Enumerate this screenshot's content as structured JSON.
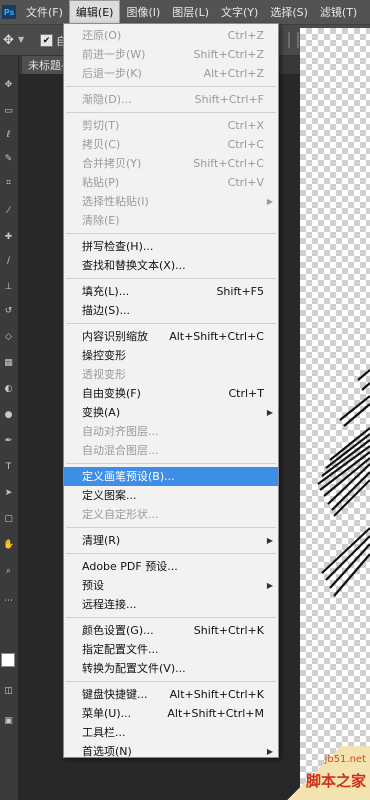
{
  "menubar": {
    "logo": "Ps",
    "items": [
      {
        "label": "文件(F)",
        "active": false
      },
      {
        "label": "编辑(E)",
        "active": true
      },
      {
        "label": "图像(I)",
        "active": false
      },
      {
        "label": "图层(L)",
        "active": false
      },
      {
        "label": "文字(Y)",
        "active": false
      },
      {
        "label": "选择(S)",
        "active": false
      },
      {
        "label": "滤镜(T)",
        "active": false
      }
    ]
  },
  "options_bar": {
    "auto_select_label": "自",
    "auto_select_checked": true
  },
  "document_tab": {
    "title": "未标题-"
  },
  "edit_menu": {
    "highlight_color": "#3f8ee6",
    "items": [
      {
        "type": "item",
        "label": "还原(O)",
        "shortcut": "Ctrl+Z",
        "disabled": true
      },
      {
        "type": "item",
        "label": "前进一步(W)",
        "shortcut": "Shift+Ctrl+Z",
        "disabled": true
      },
      {
        "type": "item",
        "label": "后退一步(K)",
        "shortcut": "Alt+Ctrl+Z",
        "disabled": true
      },
      {
        "type": "separator"
      },
      {
        "type": "item",
        "label": "渐隐(D)...",
        "shortcut": "Shift+Ctrl+F",
        "disabled": true
      },
      {
        "type": "separator"
      },
      {
        "type": "item",
        "label": "剪切(T)",
        "shortcut": "Ctrl+X",
        "disabled": true
      },
      {
        "type": "item",
        "label": "拷贝(C)",
        "shortcut": "Ctrl+C",
        "disabled": true
      },
      {
        "type": "item",
        "label": "合并拷贝(Y)",
        "shortcut": "Shift+Ctrl+C",
        "disabled": true
      },
      {
        "type": "item",
        "label": "粘贴(P)",
        "shortcut": "Ctrl+V",
        "disabled": true
      },
      {
        "type": "item",
        "label": "选择性粘贴(I)",
        "shortcut": "",
        "disabled": true,
        "submenu": true
      },
      {
        "type": "item",
        "label": "清除(E)",
        "shortcut": "",
        "disabled": true
      },
      {
        "type": "separator"
      },
      {
        "type": "item",
        "label": "拼写检查(H)...",
        "shortcut": "",
        "disabled": false
      },
      {
        "type": "item",
        "label": "查找和替换文本(X)...",
        "shortcut": "",
        "disabled": false
      },
      {
        "type": "separator"
      },
      {
        "type": "item",
        "label": "填充(L)...",
        "shortcut": "Shift+F5",
        "disabled": false
      },
      {
        "type": "item",
        "label": "描边(S)...",
        "shortcut": "",
        "disabled": false
      },
      {
        "type": "separator"
      },
      {
        "type": "item",
        "label": "内容识别缩放",
        "shortcut": "Alt+Shift+Ctrl+C",
        "disabled": false
      },
      {
        "type": "item",
        "label": "操控变形",
        "shortcut": "",
        "disabled": false
      },
      {
        "type": "item",
        "label": "透视变形",
        "shortcut": "",
        "disabled": true
      },
      {
        "type": "item",
        "label": "自由变换(F)",
        "shortcut": "Ctrl+T",
        "disabled": false
      },
      {
        "type": "item",
        "label": "变换(A)",
        "shortcut": "",
        "disabled": false,
        "submenu": true
      },
      {
        "type": "item",
        "label": "自动对齐图层...",
        "shortcut": "",
        "disabled": true
      },
      {
        "type": "item",
        "label": "自动混合图层...",
        "shortcut": "",
        "disabled": true
      },
      {
        "type": "separator"
      },
      {
        "type": "item",
        "label": "定义画笔预设(B)...",
        "shortcut": "",
        "disabled": false,
        "highlighted": true
      },
      {
        "type": "item",
        "label": "定义图案...",
        "shortcut": "",
        "disabled": false
      },
      {
        "type": "item",
        "label": "定义自定形状...",
        "shortcut": "",
        "disabled": true
      },
      {
        "type": "separator"
      },
      {
        "type": "item",
        "label": "清理(R)",
        "shortcut": "",
        "disabled": false,
        "submenu": true
      },
      {
        "type": "separator"
      },
      {
        "type": "item",
        "label": "Adobe PDF 预设...",
        "shortcut": "",
        "disabled": false
      },
      {
        "type": "item",
        "label": "预设",
        "shortcut": "",
        "disabled": false,
        "submenu": true
      },
      {
        "type": "item",
        "label": "远程连接...",
        "shortcut": "",
        "disabled": false
      },
      {
        "type": "separator"
      },
      {
        "type": "item",
        "label": "颜色设置(G)...",
        "shortcut": "Shift+Ctrl+K",
        "disabled": false
      },
      {
        "type": "item",
        "label": "指定配置文件...",
        "shortcut": "",
        "disabled": false
      },
      {
        "type": "item",
        "label": "转换为配置文件(V)...",
        "shortcut": "",
        "disabled": false
      },
      {
        "type": "separator"
      },
      {
        "type": "item",
        "label": "键盘快捷键...",
        "shortcut": "Alt+Shift+Ctrl+K",
        "disabled": false
      },
      {
        "type": "item",
        "label": "菜单(U)...",
        "shortcut": "Alt+Shift+Ctrl+M",
        "disabled": false
      },
      {
        "type": "item",
        "label": "工具栏...",
        "shortcut": "",
        "disabled": false
      },
      {
        "type": "item",
        "label": "首选项(N)",
        "shortcut": "",
        "disabled": false,
        "submenu": true
      }
    ]
  },
  "watermark": {
    "site": "jb51.net",
    "name": "脚本之家"
  }
}
